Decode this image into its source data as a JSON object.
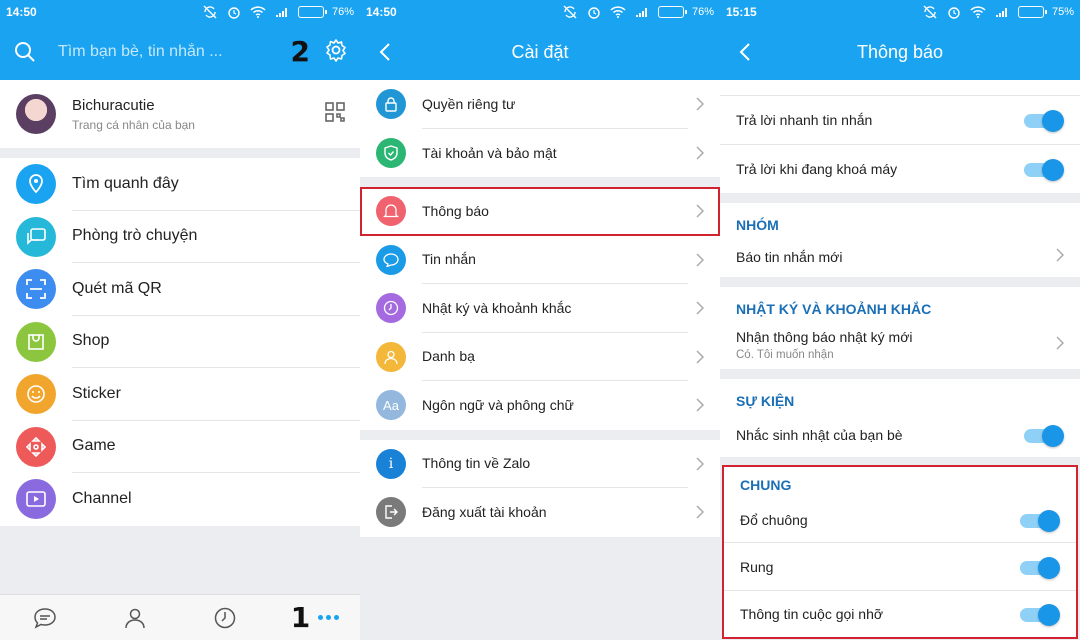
{
  "panels": [
    {
      "status": {
        "time": "14:50",
        "battery": "76%",
        "battery_level": 0.76
      },
      "search": {
        "placeholder": "Tìm bạn bè, tin nhắn ..."
      },
      "marks": {
        "top": "2",
        "bottom": "1"
      },
      "profile": {
        "name": "Bichuracutie",
        "subtitle": "Trang cá nhân của bạn"
      },
      "menu": [
        {
          "label": "Tìm quanh đây",
          "icon": "location-pin-icon",
          "color": "#1aa3f0"
        },
        {
          "label": "Phòng trò chuyện",
          "icon": "chat-rooms-icon",
          "color": "#26b8d8"
        },
        {
          "label": "Quét mã QR",
          "icon": "qr-scan-icon",
          "color": "#3d8cf0"
        },
        {
          "label": "Shop",
          "icon": "shop-bag-icon",
          "color": "#8cc63f"
        },
        {
          "label": "Sticker",
          "icon": "smiley-icon",
          "color": "#f2a52c"
        },
        {
          "label": "Game",
          "icon": "gamepad-icon",
          "color": "#ee5a5a"
        },
        {
          "label": "Channel",
          "icon": "video-channel-icon",
          "color": "#8a6adf"
        }
      ],
      "bottom_nav": [
        "messages-icon",
        "contacts-icon",
        "timeline-icon",
        "more-icon"
      ]
    },
    {
      "status": {
        "time": "14:50",
        "battery": "76%",
        "battery_level": 0.76
      },
      "title": "Cài đặt",
      "groups": [
        [
          {
            "label": "Quyền riêng tư",
            "icon": "lock-icon",
            "color": "#2196d4"
          },
          {
            "label": "Tài khoản và bảo mật",
            "icon": "shield-icon",
            "color": "#2bb673"
          }
        ],
        [
          {
            "label": "Thông báo",
            "icon": "bell-icon",
            "color": "#f0626e"
          },
          {
            "label": "Tin nhắn",
            "icon": "message-icon",
            "color": "#1a9be8"
          },
          {
            "label": "Nhật ký và khoảnh khắc",
            "icon": "clock-icon",
            "color": "#a56ae0"
          },
          {
            "label": "Danh bạ",
            "icon": "person-icon",
            "color": "#f3b73a"
          },
          {
            "label": "Ngôn ngữ và phông chữ",
            "icon": "font-icon",
            "color": "#94b8dd",
            "glyph": "Aa"
          }
        ],
        [
          {
            "label": "Thông tin về Zalo",
            "icon": "info-icon",
            "color": "#1a82d6",
            "glyph": "i"
          },
          {
            "label": "Đăng xuất tài khoản",
            "icon": "logout-icon",
            "color": "#7a7a7a"
          }
        ]
      ]
    },
    {
      "status": {
        "time": "15:15",
        "battery": "75%",
        "battery_level": 0.75
      },
      "title": "Thông báo",
      "top_items": [
        {
          "label": "Trả lời nhanh tin nhắn"
        },
        {
          "label": "Trả lời khi đang khoá máy"
        }
      ],
      "nhom": {
        "title": "NHÓM",
        "item": "Báo tin nhắn mới"
      },
      "nhat_ky": {
        "title": "NHẬT KÝ VÀ KHOẢNH KHẮC",
        "item": "Nhận thông báo nhật ký mới",
        "sub": "Có. Tôi muốn nhận"
      },
      "su_kien": {
        "title": "SỰ KIỆN",
        "item": "Nhắc sinh nhật của bạn bè"
      },
      "chung": {
        "title": "CHUNG",
        "items": [
          {
            "label": "Đổ chuông"
          },
          {
            "label": "Rung"
          },
          {
            "label": "Thông tin cuộc gọi nhỡ"
          }
        ]
      }
    }
  ]
}
